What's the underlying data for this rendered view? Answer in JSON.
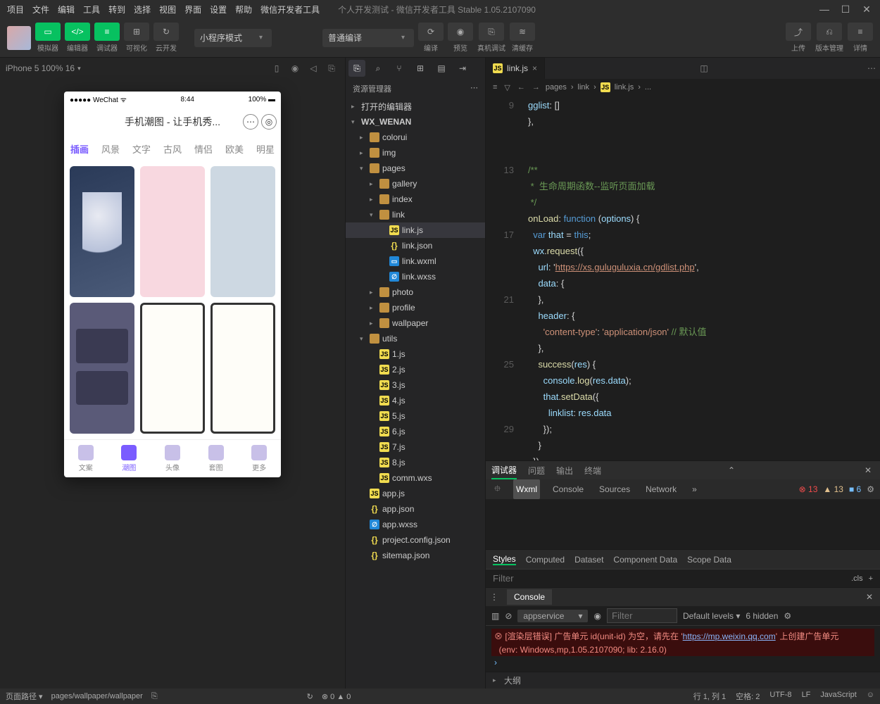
{
  "menus": [
    "项目",
    "文件",
    "编辑",
    "工具",
    "转到",
    "选择",
    "视图",
    "界面",
    "设置",
    "帮助",
    "微信开发者工具"
  ],
  "title": "个人开发测试 - 微信开发者工具 Stable 1.05.2107090",
  "toolbar": {
    "simulator": "模拟器",
    "editor": "编辑器",
    "debugger": "调试器",
    "visualize": "可视化",
    "cloud": "云开发",
    "mode": "小程序模式",
    "compile_mode": "普通编译",
    "compile": "编译",
    "preview": "预览",
    "remote": "真机调试",
    "cache": "清缓存",
    "upload": "上传",
    "version": "版本管理",
    "details": "详情"
  },
  "sim": {
    "device": "iPhone 5 100% 16"
  },
  "phone": {
    "carrier": "WeChat",
    "time": "8:44",
    "battery": "100%",
    "title": "手机潮图 - 让手机秀...",
    "tabs": [
      "插画",
      "风景",
      "文字",
      "古风",
      "情侣",
      "欧美",
      "明星"
    ],
    "bottom": [
      "文案",
      "潮图",
      "头像",
      "套图",
      "更多"
    ]
  },
  "explorer": {
    "header": "资源管理器",
    "opened": "打开的编辑器",
    "project": "WX_WENAN",
    "tree": {
      "colorui": "colorui",
      "img": "img",
      "pages": "pages",
      "gallery": "gallery",
      "index": "index",
      "link": "link",
      "linkjs": "link.js",
      "linkjson": "link.json",
      "linkwxml": "link.wxml",
      "linkwxss": "link.wxss",
      "photo": "photo",
      "profile": "profile",
      "wallpaper": "wallpaper",
      "utils": "utils",
      "u1": "1.js",
      "u2": "2.js",
      "u3": "3.js",
      "u4": "4.js",
      "u5": "5.js",
      "u6": "6.js",
      "u7": "7.js",
      "u8": "8.js",
      "comm": "comm.wxs",
      "appjs": "app.js",
      "appjson": "app.json",
      "appwxss": "app.wxss",
      "projconf": "project.config.json",
      "sitemap": "sitemap.json"
    },
    "outline": "大纲"
  },
  "editor": {
    "tab": "link.js",
    "breadcrumb": [
      "pages",
      "link",
      "link.js",
      "..."
    ],
    "code": {
      "gglist": "gglist",
      "onload": "onLoad",
      "function": "function",
      "options": "options",
      "var": "var",
      "that": "that",
      "this": "this",
      "wx": "wx",
      "request": "request",
      "url_k": "url",
      "url_v": "https://xs.guluguluxia.cn/gdlist.php",
      "data_k": "data",
      "header_k": "header",
      "ct_k": "content-type",
      "ct_v": "application/json",
      "ct_cm": "// 默认值",
      "success": "success",
      "res": "res",
      "console": "console",
      "log": "log",
      "resdata": "res.data",
      "setData": "setData",
      "linklist": "linklist",
      "comment1": "/**",
      "comment2": " *  生命周期函数--监听页面加载",
      "comment3": " */"
    }
  },
  "dbg": {
    "tabs": [
      "调试器",
      "问题",
      "输出",
      "终端"
    ],
    "dev": [
      "Wxml",
      "Console",
      "Sources",
      "Network"
    ],
    "err": "13",
    "warn": "13",
    "info": "6",
    "styles": [
      "Styles",
      "Computed",
      "Dataset",
      "Component Data",
      "Scope Data"
    ],
    "filter": "Filter",
    "cls": ".cls"
  },
  "console": {
    "tab": "Console",
    "context": "appservice",
    "filter_ph": "Filter",
    "levels": "Default levels",
    "hidden": "6 hidden",
    "err1": "[渲染层错误] 广告单元 id(unit-id) 为空，请先在 '",
    "err_link": "https://mp.weixin.qq.com",
    "err1b": "' 上创建广告单元",
    "err2": "(env: Windows,mp,1.05.2107090; lib: 2.16.0)"
  },
  "status": {
    "route_lbl": "页面路径",
    "route": "pages/wallpaper/wallpaper",
    "stat_center": "0",
    "stat_center2": "0",
    "pos": "行 1, 列 1",
    "spaces": "空格: 2",
    "enc": "UTF-8",
    "eol": "LF",
    "lang": "JavaScript"
  }
}
